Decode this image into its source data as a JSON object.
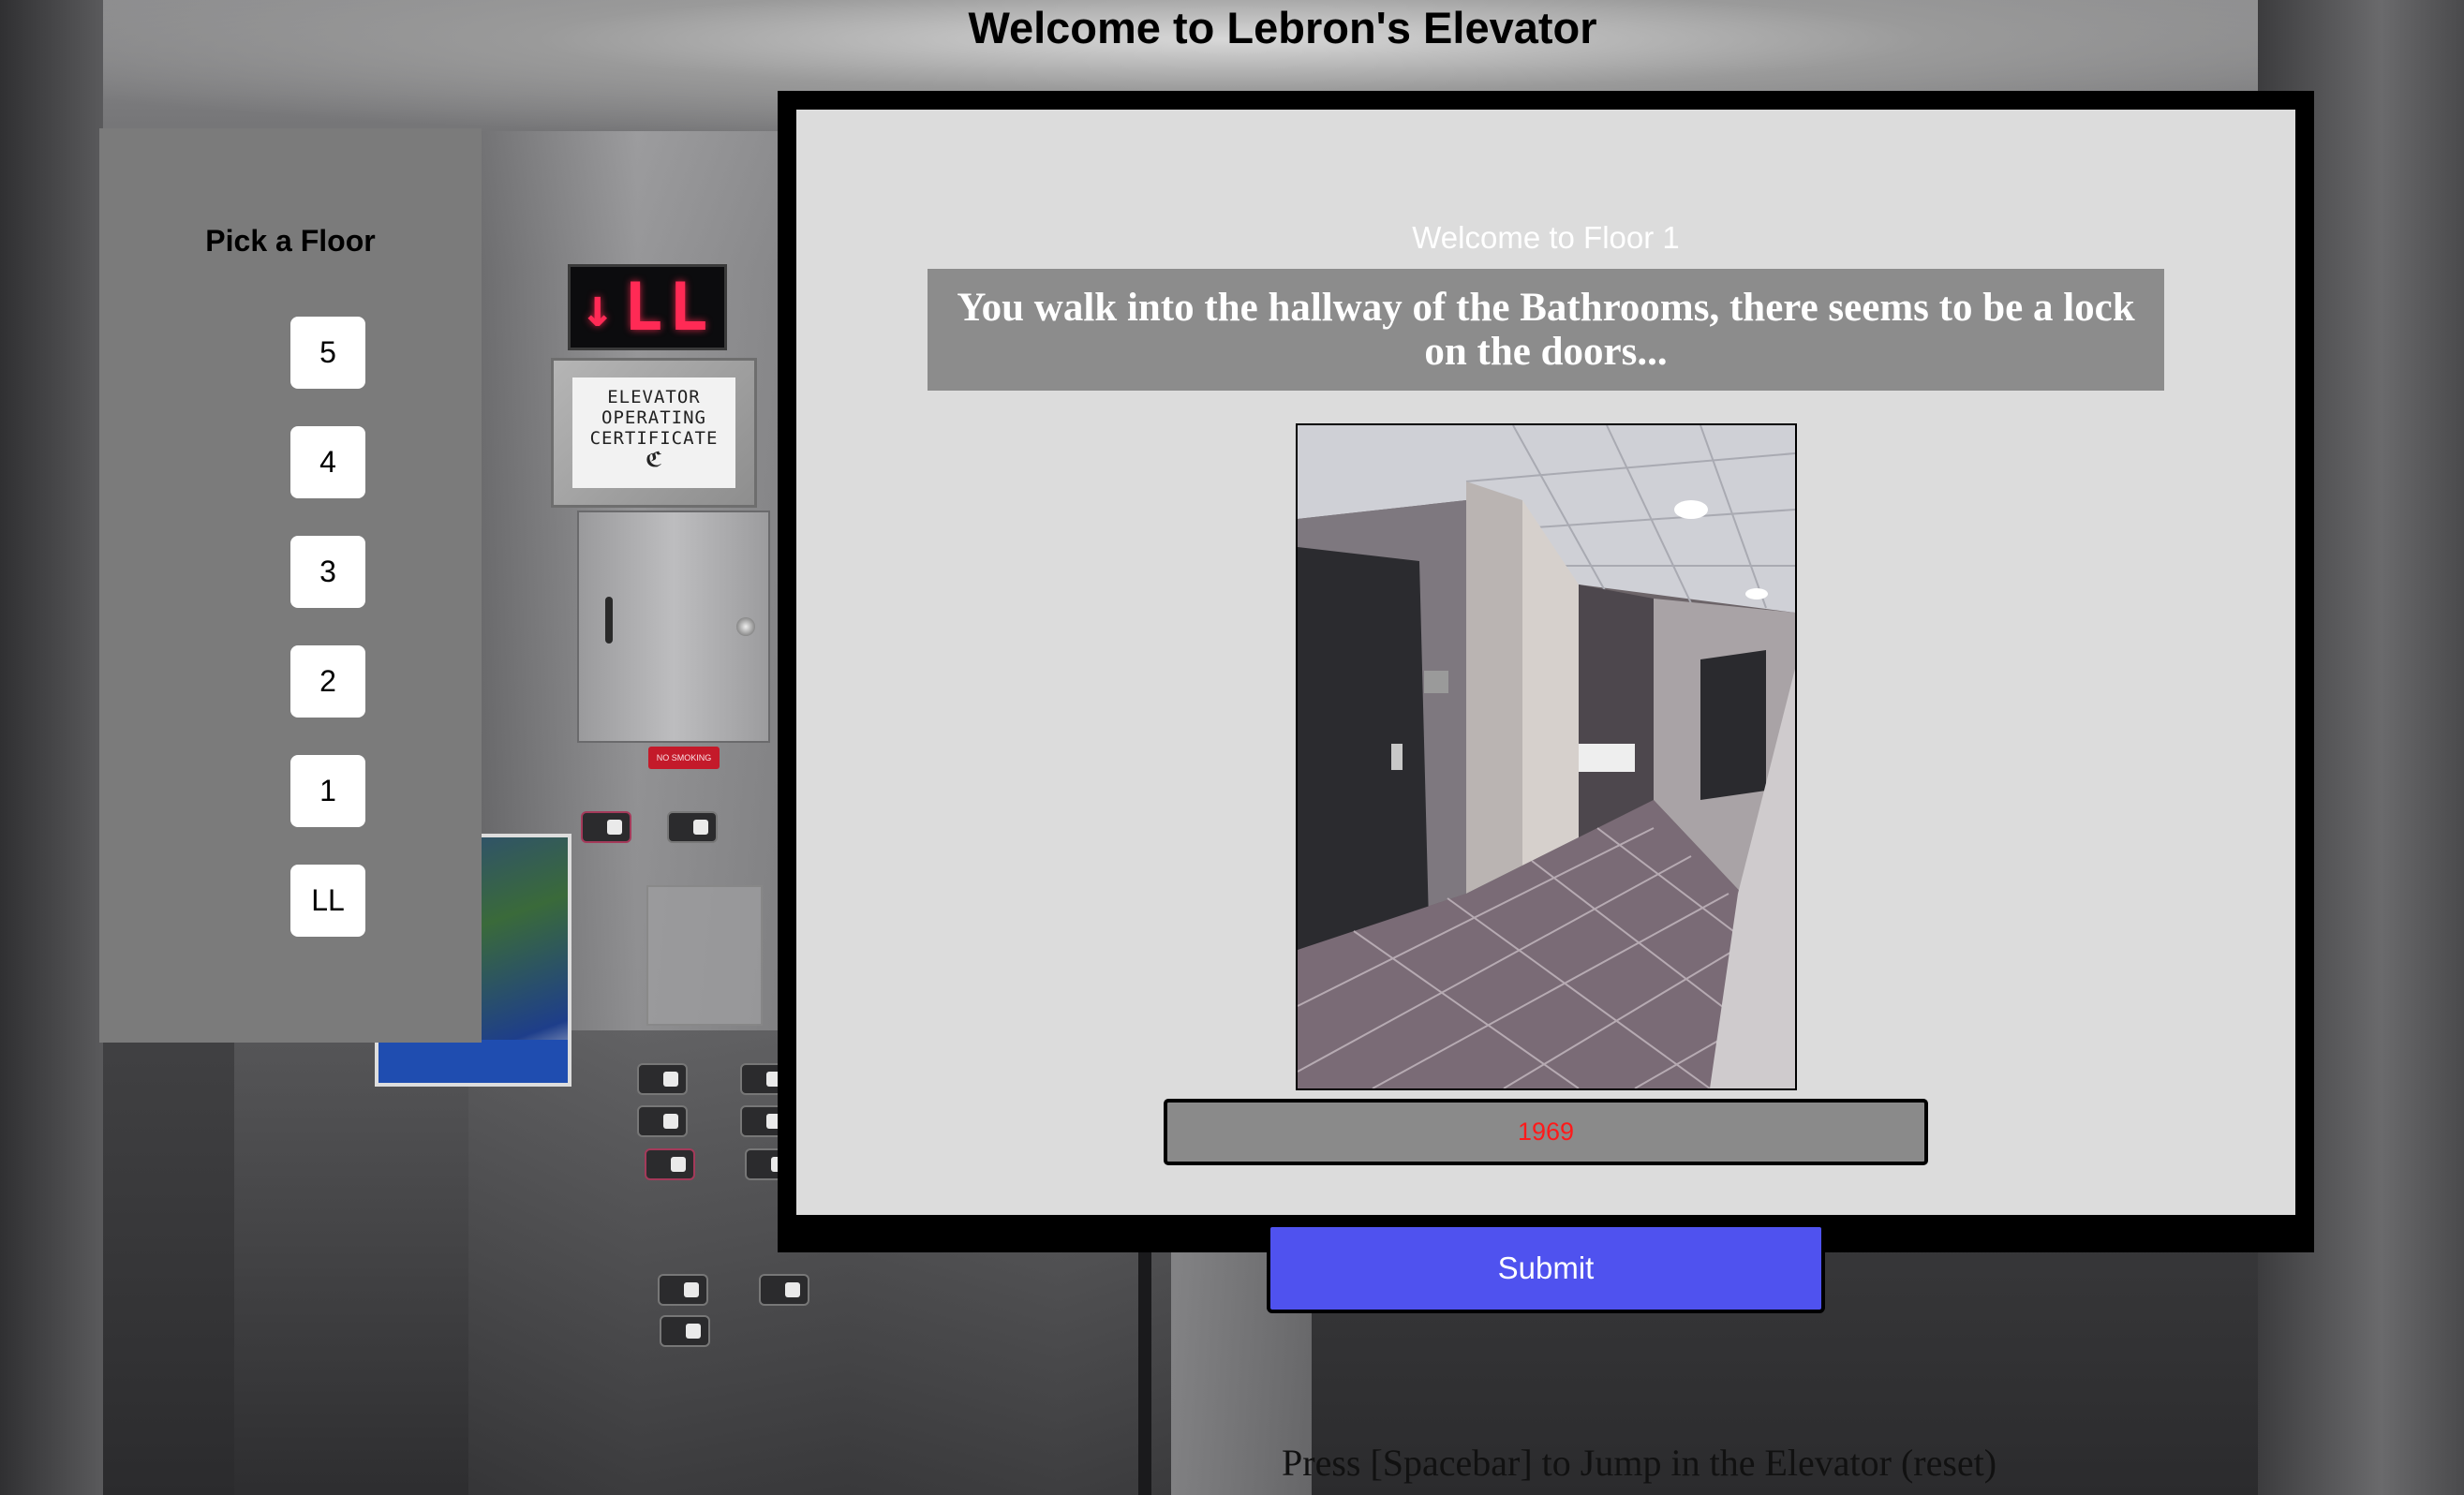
{
  "page": {
    "title": "Welcome to Lebron's Elevator",
    "hint": "Press [Spacebar] to Jump in the Elevator (reset)"
  },
  "picker": {
    "title": "Pick a Floor",
    "floors": [
      "5",
      "4",
      "3",
      "2",
      "1",
      "LL"
    ]
  },
  "elevator_background": {
    "floor_indicator": {
      "arrow": "↓",
      "floor": "LL"
    },
    "certificate": [
      "ELEVATOR",
      "OPERATING",
      "CERTIFICATE"
    ],
    "no_smoking": "NO SMOKING"
  },
  "modal": {
    "floor_welcome": "Welcome to Floor 1",
    "story": "You walk into the hallway of the Bathrooms, there seems to be a lock on the doors...",
    "scene_photo_icon": "hallway-photo",
    "answer_value": "1969",
    "submit_label": "Submit"
  },
  "colors": {
    "picker_bg": "#7b7b7b",
    "modal_border": "#000000",
    "modal_bg": "#dcdcdc",
    "story_bg": "#8c8c8c",
    "submit_bg": "#4f52ef",
    "answer_text": "#ff1a1a",
    "floor_indicator_led": "#ff2a55"
  }
}
